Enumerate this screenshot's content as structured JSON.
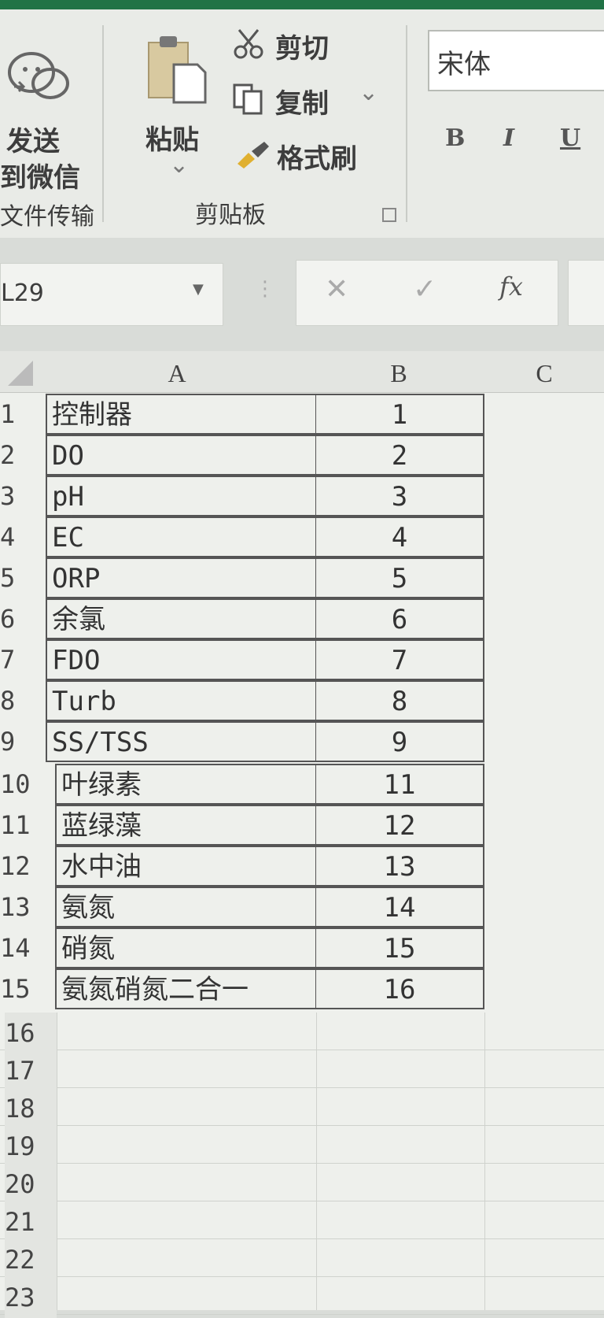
{
  "ribbon": {
    "send_wechat": {
      "line1": "发送",
      "line2": "到微信",
      "group": "文件传输"
    },
    "paste": {
      "label": "粘贴",
      "arrow": "⌄"
    },
    "cut": {
      "label": "剪切",
      "icon": "scissors-icon"
    },
    "copy": {
      "label": "复制",
      "arrow": "⌄",
      "icon": "copy-icon"
    },
    "format_painter": {
      "label": "格式刷",
      "icon": "brush-icon"
    },
    "clipboard_group": "剪贴板",
    "font_name": "宋体",
    "bold": "B",
    "italic": "I",
    "underline": "U"
  },
  "formula_bar": {
    "name_box": "L29",
    "cancel": "✕",
    "enter": "✓",
    "fx": "fx"
  },
  "sheet": {
    "columns": [
      "A",
      "B",
      "C"
    ],
    "rows": [
      {
        "num": "1",
        "a": "控制器",
        "b": "1"
      },
      {
        "num": "2",
        "a": "DO",
        "b": "2"
      },
      {
        "num": "3",
        "a": "pH",
        "b": "3"
      },
      {
        "num": "4",
        "a": "EC",
        "b": "4"
      },
      {
        "num": "5",
        "a": "ORP",
        "b": "5"
      },
      {
        "num": "6",
        "a": "余氯",
        "b": "6"
      },
      {
        "num": "7",
        "a": "FDO",
        "b": "7"
      },
      {
        "num": "8",
        "a": "Turb",
        "b": "8"
      },
      {
        "num": "9",
        "a": "SS/TSS",
        "b": "9"
      },
      {
        "num": "10",
        "a": "叶绿素",
        "b": "11"
      },
      {
        "num": "11",
        "a": "蓝绿藻",
        "b": "12"
      },
      {
        "num": "12",
        "a": "水中油",
        "b": "13"
      },
      {
        "num": "13",
        "a": "氨氮",
        "b": "14"
      },
      {
        "num": "14",
        "a": "硝氮",
        "b": "15"
      },
      {
        "num": "15",
        "a": "氨氮硝氮二合一",
        "b": "16"
      }
    ],
    "empty_rows": [
      "16",
      "17",
      "18",
      "19",
      "20",
      "21",
      "22",
      "23"
    ]
  }
}
